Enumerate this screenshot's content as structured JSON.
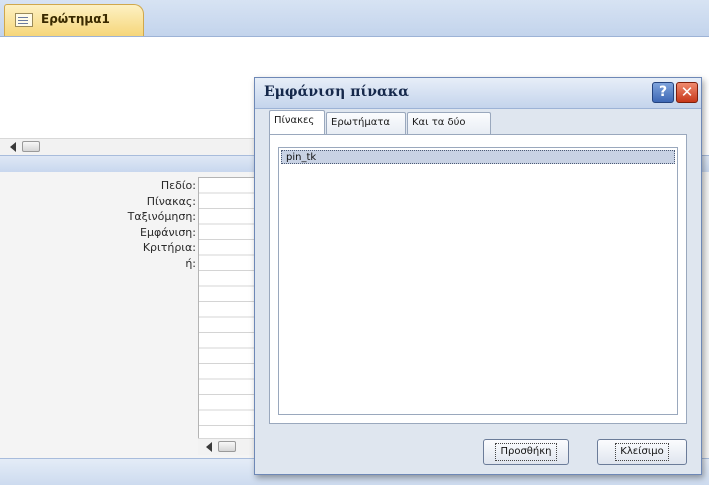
{
  "document_tab": {
    "label": "Ερώτημα1"
  },
  "design_grid": {
    "row_labels": [
      "Πεδίο:",
      "Πίνακας:",
      "Ταξινόμηση:",
      "Εμφάνιση:",
      "Κριτήρια:",
      "ή:"
    ]
  },
  "dialog": {
    "title": "Εμφάνιση πίνακα",
    "help_glyph": "?",
    "close_glyph": "✕",
    "tabs": [
      {
        "label": "Πίνακες",
        "active": true
      },
      {
        "label": "Ερωτήματα",
        "active": false
      },
      {
        "label": "Και τα δύο",
        "active": false
      }
    ],
    "list_items": [
      "pin_tk"
    ],
    "buttons": {
      "add": "Προσθήκη",
      "close": "Κλείσιμο"
    }
  },
  "colors": {
    "tab_accent": "#f6d67a",
    "highlight_strip": "#ffe000",
    "selection": "#c8d2e4",
    "close_button": "#c7381b",
    "help_button": "#3d67b5"
  }
}
